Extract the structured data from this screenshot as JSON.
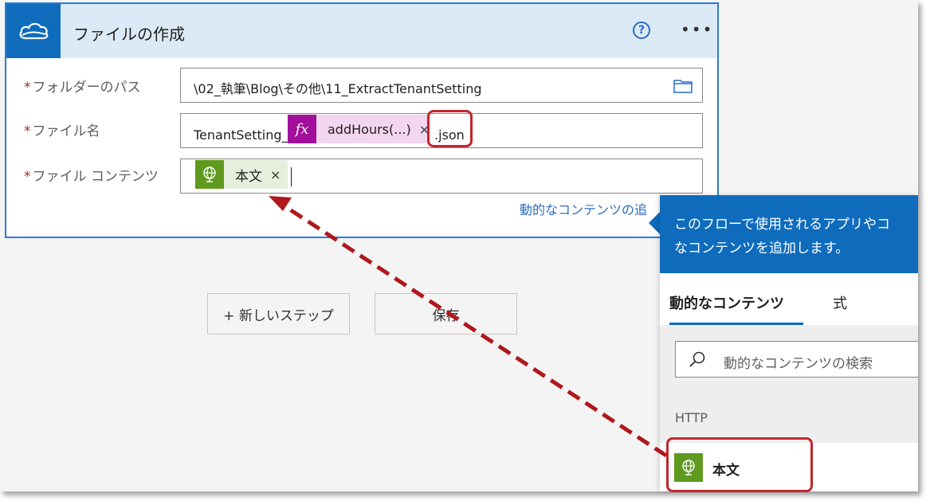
{
  "card": {
    "title": "ファイルの作成",
    "help_glyph": "?",
    "more_glyph": "•••",
    "required_marker": "*",
    "fields": {
      "folder": {
        "label": "フォルダーのパス",
        "value": "\\02_執筆\\Blog\\その他\\11_ExtractTenantSetting"
      },
      "filename": {
        "label": "ファイル名",
        "prefix": "TenantSetting_",
        "token_icon": "fx",
        "token_label": "addHours(...)",
        "token_close": "×",
        "suffix": ".json"
      },
      "content": {
        "label": "ファイル コンテンツ",
        "token_label": "本文",
        "token_close": "×"
      }
    },
    "dynamic_link": "動的なコンテンツの追"
  },
  "buttons": {
    "new_step": "+ 新しいステップ",
    "save": "保存"
  },
  "panel": {
    "description_line1": "このフローで使用されるアプリやコ",
    "description_line2": "なコンテンツを追加します。",
    "tabs": [
      "動的なコンテンツ",
      "式"
    ],
    "active_tab": "動的なコンテンツ",
    "search_placeholder": "動的なコンテンツの検索",
    "section": "HTTP",
    "items": [
      {
        "label": "本文"
      }
    ]
  },
  "colors": {
    "accent": "#0f6cbd",
    "highlight": "#c1272d",
    "expression_token": "#a20f9b",
    "http_token": "#5f9a1f"
  },
  "icons": [
    "onedrive-cloud-icon",
    "help-icon",
    "more-icon",
    "folder-icon",
    "fx-icon",
    "globe-icon",
    "search-icon",
    "close-icon"
  ]
}
